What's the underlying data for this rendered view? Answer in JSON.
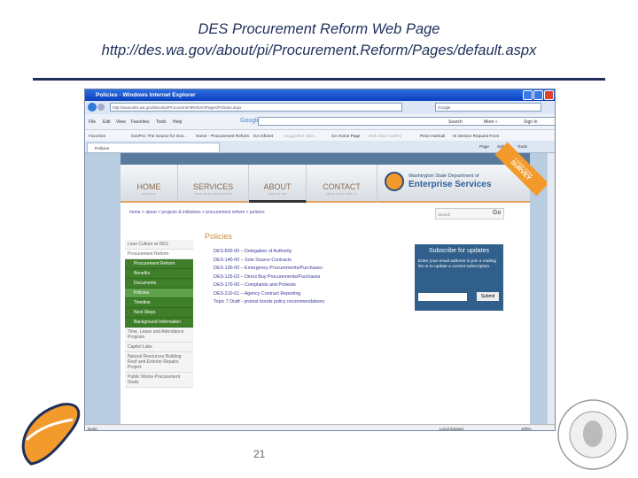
{
  "slide": {
    "title": "DES Procurement Reform Web Page",
    "url": "http://des.wa.gov/about/pi/Procurement.Reform/Pages/default.aspx",
    "page_number": "21"
  },
  "browser": {
    "window_title": "Policies - Windows Internet Explorer",
    "address": "http://www.des.wa.gov/about/pi/ProcurementReform/Pages/Policies.aspx",
    "search_placeholder": "Google",
    "menu": [
      "File",
      "Edit",
      "View",
      "Favorites",
      "Tools",
      "Help"
    ],
    "google_label": "Google",
    "search_btn": "Search",
    "more": "More »",
    "sign_in": "Sign In",
    "favorites_label": "Favorites",
    "favorites": [
      "GovPro: The Source for Gov...",
      "Home - Procurement Reform",
      "GA Infonet",
      "Suggested Sites",
      "GA Home Page",
      "Web Slice Gallery",
      "Peon Hotmail",
      "IS Service Request Form"
    ],
    "tab": "Policies",
    "cmd": [
      "Page",
      "Safety",
      "Tools"
    ],
    "status_left": "Done",
    "zone": "Local intranet",
    "zoom": "100%"
  },
  "site": {
    "nav": [
      {
        "label": "HOME",
        "sub": "welcome"
      },
      {
        "label": "SERVICES",
        "sub": "what we do and provide"
      },
      {
        "label": "ABOUT",
        "sub": "who we are"
      },
      {
        "label": "CONTACT",
        "sub": "get in touch with us"
      }
    ],
    "logo_line1": "Washington State Department of",
    "logo_line2": "Enterprise Services",
    "survey_small": "2 minute survey",
    "survey": "SURVEY",
    "breadcrumb": "home > about > projects & initiatives > procurement reform > policies",
    "search_placeholder": "Search",
    "go": "Go",
    "sidebar": [
      "Lean Culture at DES",
      "Procurement Reform",
      "Procurement Reform",
      "Benefits",
      "Documents",
      "Policies",
      "Timeline",
      "Next Steps",
      "Background Information",
      "Time, Leave and Attendance Program",
      "Capitol Lake",
      "Natural Resources Building Roof and Exterior Repairs Project",
      "Public Works Procurement Study"
    ],
    "heading": "Policies",
    "policies": [
      "DES-600-00 – Delegation of Authority",
      "DES-140-00 – Sole Source Contracts",
      "DES-130-00 – Emergency Procurements/Purchases",
      "DES-125-03 – Direct Buy Procurements/Purchases",
      "DES-170-00 – Complaints and Protests",
      "DES-210-01 – Agency Contract Reporting",
      "Topic 7 Draft - protest bonds policy recommendations"
    ],
    "subscribe": {
      "title": "Subscribe for updates",
      "text": "Enter your email address to join a mailing list or to update a current subscription.",
      "button": "Submit"
    }
  },
  "colors": {
    "title": "#1f2f5a",
    "green": "#3f7f2a",
    "orange": "#f39a2c",
    "link": "#3a3a99"
  }
}
